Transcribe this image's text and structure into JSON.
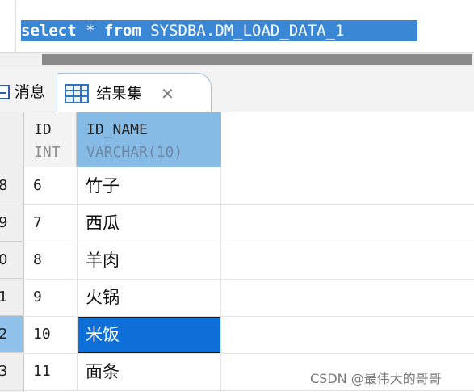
{
  "editor": {
    "sql": {
      "keyword_select": "select",
      "star": "*",
      "keyword_from": "from",
      "table": "SYSDBA.DM_LOAD_DATA_1"
    }
  },
  "tabs": [
    {
      "label": "消息",
      "icon": "message-icon"
    },
    {
      "label": "结果集",
      "icon": "table-grid-icon",
      "close": "✕",
      "active": true
    }
  ],
  "columns": [
    {
      "name": "ID",
      "type": "INT"
    },
    {
      "name": "ID_NAME",
      "type": "VARCHAR(10)"
    }
  ],
  "rows": [
    {
      "rownum": "8",
      "id": "6",
      "name": "竹子"
    },
    {
      "rownum": "9",
      "id": "7",
      "name": "西瓜"
    },
    {
      "rownum": "0",
      "id": "8",
      "name": "羊肉"
    },
    {
      "rownum": "1",
      "id": "9",
      "name": "火锅"
    },
    {
      "rownum": "2",
      "id": "10",
      "name": "米饭",
      "selected": true
    },
    {
      "rownum": "3",
      "id": "11",
      "name": "面条"
    }
  ],
  "watermark": "CSDN @最伟大的哥哥",
  "colors": {
    "selection": "#3a87d6",
    "selected_cell": "#0f6fd8",
    "header_selected": "#86bbe6"
  }
}
